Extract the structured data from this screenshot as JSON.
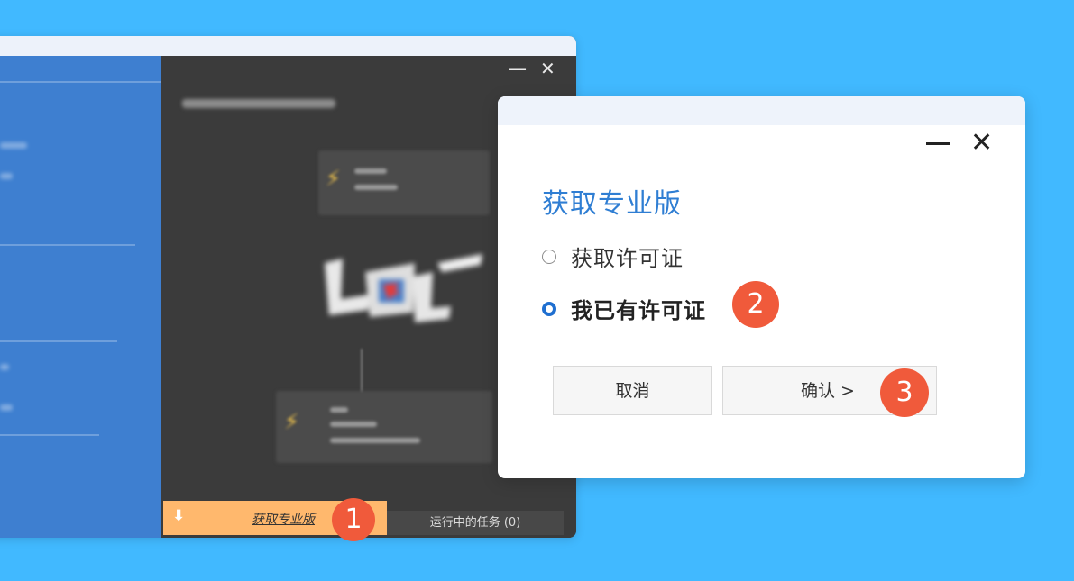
{
  "app": {
    "pro_bar_label": "获取专业版",
    "tasks_label": "运行中的任务 (0)",
    "min_glyph": "—",
    "close_glyph": "✕",
    "download_glyph": "⬇"
  },
  "dialog": {
    "title": "获取专业版",
    "options": [
      {
        "label": "获取许可证",
        "selected": false
      },
      {
        "label": "我已有许可证",
        "selected": true
      }
    ],
    "cancel_label": "取消",
    "confirm_label": "确认 >",
    "close_glyph": "✕"
  },
  "badges": [
    "1",
    "2",
    "3"
  ],
  "colors": {
    "background": "#41b9ff",
    "accent": "#2f7ed3",
    "pro_bar": "#ffb86d",
    "badge": "#f05a3b"
  }
}
